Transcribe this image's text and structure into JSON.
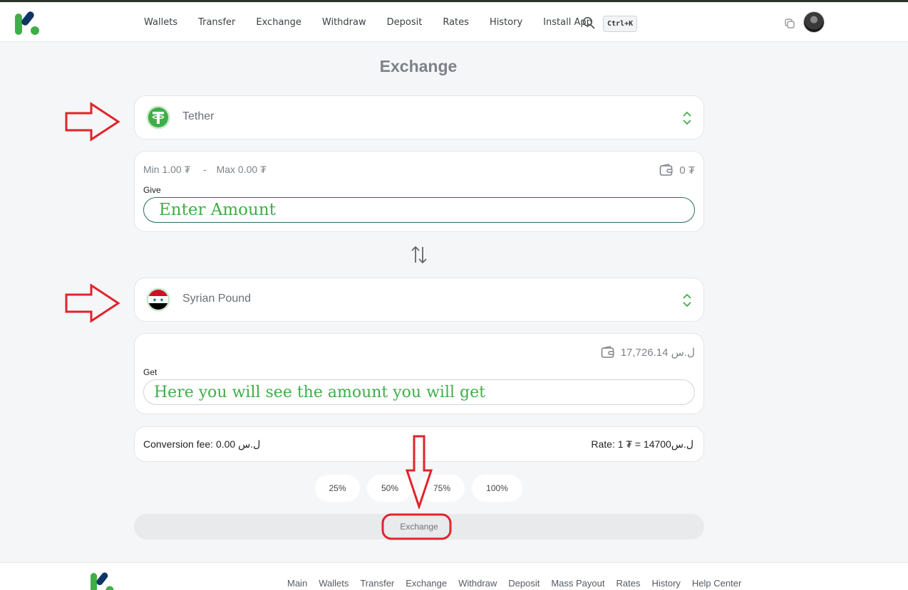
{
  "header": {
    "nav": [
      "Wallets",
      "Transfer",
      "Exchange",
      "Withdraw",
      "Deposit",
      "Rates",
      "History",
      "Install App"
    ],
    "shortcut": "Ctrl+K"
  },
  "page": {
    "title": "Exchange"
  },
  "from": {
    "currency": "Tether",
    "min": "Min 1.00 ₮",
    "separator": "-",
    "max": "Max 0.00 ₮",
    "balance": "0 ₮",
    "label": "Give",
    "placeholder": "Enter Amount"
  },
  "to": {
    "currency": "Syrian Pound",
    "balance": "17,726.14 ل.س",
    "label": "Get",
    "placeholder": "Here you will see the amount you will get"
  },
  "fee": {
    "conversion": "Conversion fee: 0.00 ل.س",
    "rate": "Rate: 1 ₮ = 14700ل.س"
  },
  "percent_buttons": [
    "25%",
    "50%",
    "75%",
    "100%"
  ],
  "submit_label": "Exchange",
  "footer": {
    "nav": [
      "Main",
      "Wallets",
      "Transfer",
      "Exchange",
      "Withdraw",
      "Deposit",
      "Mass Payout",
      "Rates",
      "History",
      "Help Center"
    ]
  },
  "colors": {
    "brand_green": "#3fae49",
    "brand_navy": "#0e3566",
    "annotation_red": "#e0242b"
  }
}
